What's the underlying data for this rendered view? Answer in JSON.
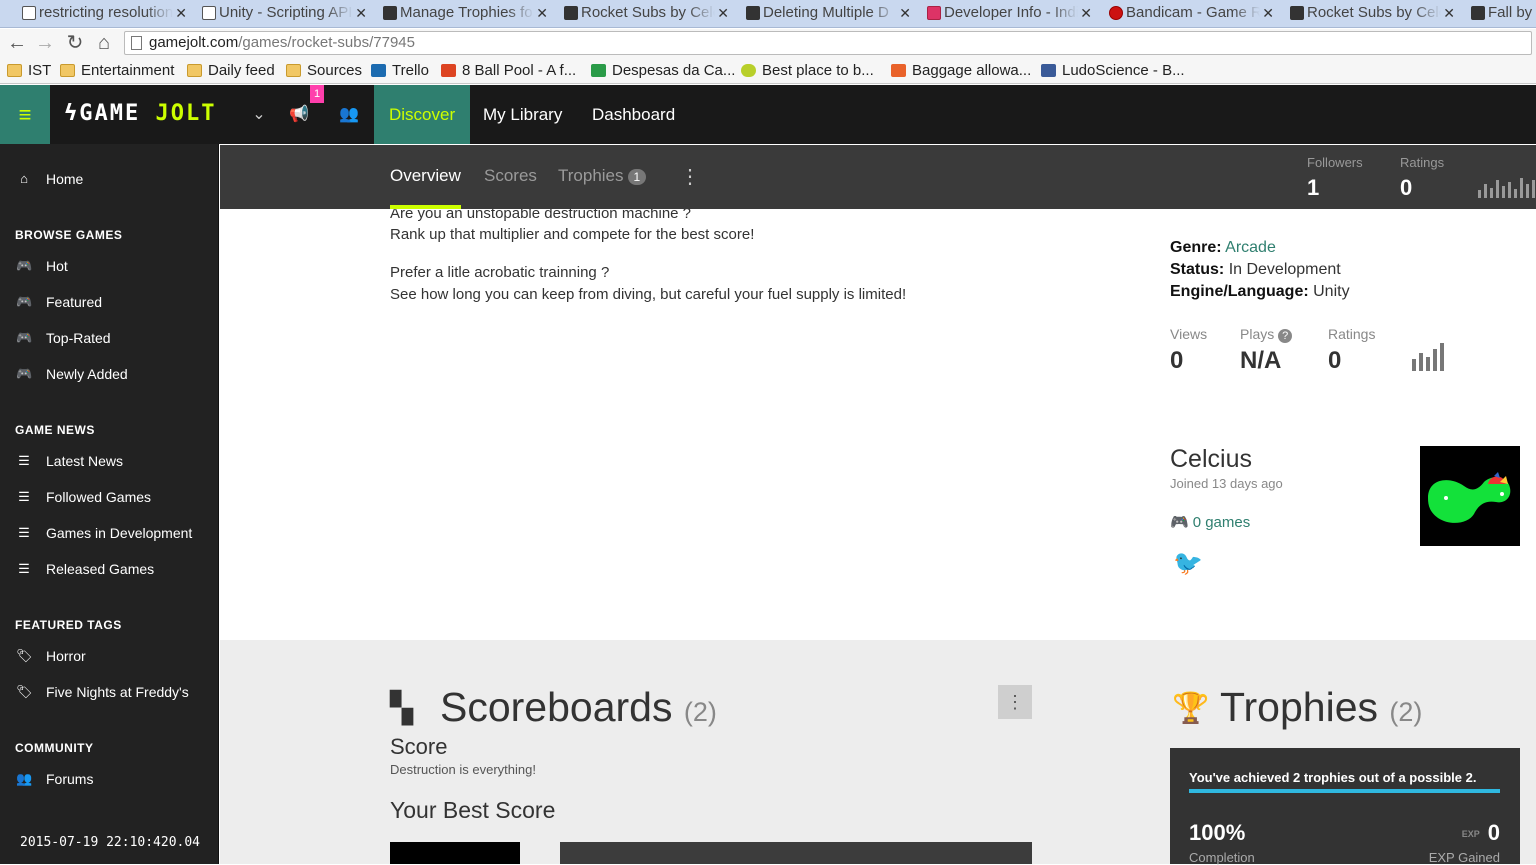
{
  "browser": {
    "tabs": [
      {
        "title": "restricting resolution",
        "icon": "unity"
      },
      {
        "title": "Unity - Scripting API",
        "icon": "unity"
      },
      {
        "title": "Manage Trophies for",
        "icon": "gamejolt"
      },
      {
        "title": "Rocket Subs by Celcius",
        "icon": "gamejolt"
      },
      {
        "title": "Deleting Multiple D",
        "icon": "gamejolt"
      },
      {
        "title": "Developer Info - Indie",
        "icon": "pink"
      },
      {
        "title": "Bandicam - Game Recording",
        "icon": "record"
      },
      {
        "title": "Rocket Subs by Celcius",
        "icon": "gamejolt",
        "active": true
      },
      {
        "title": "Fall by",
        "icon": "gamejolt"
      }
    ],
    "url_host": "gamejolt.com",
    "url_path": "/games/rocket-subs/77945",
    "bookmarks": [
      {
        "label": "IST",
        "icon": "folder"
      },
      {
        "label": "Entertainment",
        "icon": "folder"
      },
      {
        "label": "Daily feed",
        "icon": "folder"
      },
      {
        "label": "Sources",
        "icon": "folder"
      },
      {
        "label": "Trello",
        "icon": "trello"
      },
      {
        "label": "8 Ball Pool - A f...",
        "icon": "yt"
      },
      {
        "label": "Despesas da Ca...",
        "icon": "sheet"
      },
      {
        "label": "Best place to b...",
        "icon": "smile"
      },
      {
        "label": "Baggage allowa...",
        "icon": "orange"
      },
      {
        "label": "LudoScience - B...",
        "icon": "fb"
      }
    ]
  },
  "header": {
    "logo_prefix": "GAME ",
    "logo_suffix": "JOLT",
    "notif_count": "1",
    "nav": [
      "Discover",
      "My Library",
      "Dashboard"
    ]
  },
  "sidebar": {
    "home": "Home",
    "browse_heading": "BROWSE GAMES",
    "browse": [
      "Hot",
      "Featured",
      "Top-Rated",
      "Newly Added"
    ],
    "news_heading": "GAME NEWS",
    "news": [
      "Latest News",
      "Followed Games",
      "Games in Development",
      "Released Games"
    ],
    "tags_heading": "FEATURED TAGS",
    "tags": [
      "Horror",
      "Five Nights at Freddy's"
    ],
    "community_heading": "COMMUNITY",
    "community": [
      "Forums"
    ],
    "timestamp": "2015-07-19 22:10:420.04"
  },
  "gamenav": {
    "tabs": [
      "Overview",
      "Scores",
      "Trophies"
    ],
    "trophies_count": "1",
    "followers_label": "Followers",
    "followers_value": "1",
    "ratings_label": "Ratings",
    "ratings_value": "0"
  },
  "overview": {
    "desc_lines": [
      "Are you an unstopable destruction machine ?",
      "Rank up that multiplier and compete for the best score!",
      "Prefer a litle acrobatic trainning ?",
      "See how long you can keep from diving, but careful your fuel supply is limited!"
    ],
    "genre_label": "Genre:",
    "genre_value": "Arcade",
    "status_label": "Status:",
    "status_value": "In Development",
    "engine_label": "Engine/Language:",
    "engine_value": "Unity",
    "views_label": "Views",
    "views_value": "0",
    "plays_label": "Plays",
    "plays_value": "N/A",
    "ratings_label": "Ratings",
    "ratings_value": "0",
    "dev_name": "Celcius",
    "dev_joined": "Joined 13 days ago",
    "dev_games": "0 games"
  },
  "scoreboards": {
    "title": "Scoreboards",
    "count": "(2)",
    "board_name": "Score",
    "board_desc": "Destruction is everything!",
    "best_heading": "Your Best Score"
  },
  "trophies": {
    "title": "Trophies",
    "count": "(2)",
    "summary": "You've achieved 2 trophies out of a possible 2.",
    "completion_value": "100%",
    "completion_label": "Completion",
    "exp_icon_text": "EXP",
    "exp_value": "0",
    "exp_label": "EXP Gained",
    "progress_fraction": 1.0
  },
  "colors": {
    "brand_green": "#2f7f6f",
    "accent_lime": "#ccff00",
    "notif_pink": "#ff3fac",
    "progress_blue": "#2fb8e0"
  }
}
